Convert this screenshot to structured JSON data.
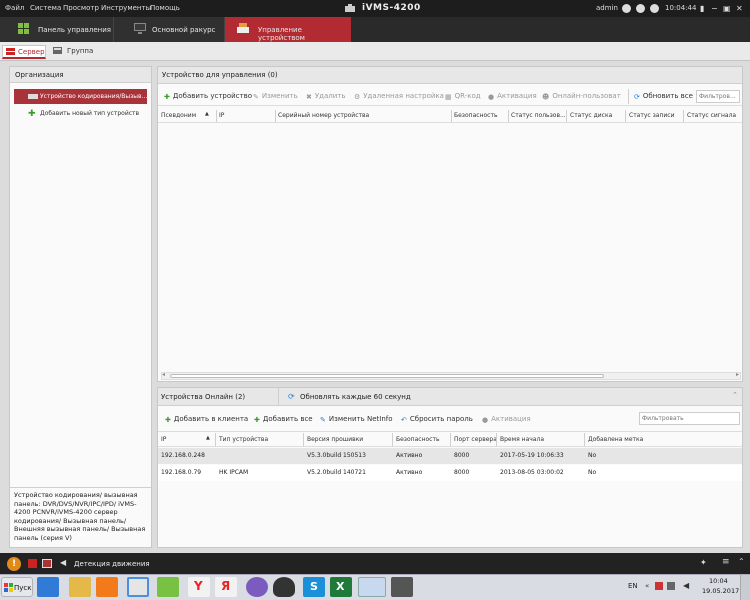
{
  "menu": {
    "items": [
      "Файл",
      "Система",
      "Просмотр",
      "Инструменты",
      "Помощь"
    ],
    "app_title": "iVMS-4200",
    "user": "admin",
    "time": "10:04:44"
  },
  "tabs": [
    {
      "label": "Панель управления",
      "active": false
    },
    {
      "label": "Основной ракурс",
      "active": false
    },
    {
      "label": "Управление устройством",
      "active": true
    }
  ],
  "subtabs": [
    {
      "label": "Сервер",
      "active": true
    },
    {
      "label": "Группа",
      "active": false
    }
  ],
  "left": {
    "header": "Организация",
    "items": [
      {
        "label": "Устройство кодирования/Вызыв...",
        "selected": true
      },
      {
        "label": "Добавить новый тип устройств",
        "selected": false
      }
    ],
    "description": "Устройство кодирования/ вызывная панель: DVR/DVS/NVR/IPC/IPD/ iVMS-4200 PCNVR/iVMS-4200 сервер кодирования/ Вызывная панель/ Внешняя вызывная панель/ Вызывная панель (серия V)"
  },
  "managed": {
    "header": "Устройство для управления (0)",
    "toolbar": {
      "add": "Добавить устройство",
      "edit": "Изменить",
      "delete": "Удалить",
      "remote": "Удаленная настройка",
      "qr": "QR-код",
      "activate": "Активация",
      "online_user": "Онлайн-пользоват",
      "refresh_all": "Обновить все",
      "filter_placeholder": "Фильтров..."
    },
    "columns": [
      "Псевдоним",
      "IP",
      "Серийный номер устройства",
      "Безопасность",
      "Статус пользов...",
      "Статус диска",
      "Статус записи",
      "Статус сигнала"
    ]
  },
  "online": {
    "header": "Устройства Онлайн (2)",
    "refresh": "Обновлять каждые 60 секунд",
    "toolbar": {
      "add_client": "Добавить в клиента",
      "add_all": "Добавить все",
      "edit_netinfo": "Изменить NetInfo",
      "reset_pw": "Сбросить пароль",
      "activate": "Активация",
      "filter_placeholder": "Фильтровать"
    },
    "columns": [
      "IP",
      "Тип устройства",
      "Версия прошивки",
      "Безопасность",
      "Порт сервера",
      "Время начала",
      "Добавлена метка"
    ],
    "rows": [
      [
        "192.168.0.248",
        "",
        "V5.3.0build 150513",
        "Активно",
        "8000",
        "2017-05-19 10:06:33",
        "No"
      ],
      [
        "192.168.0.79",
        "HK IPCAM",
        "V5.2.0build 140721",
        "Активно",
        "8000",
        "2013-08-05 03:00:02",
        "No"
      ]
    ]
  },
  "status": {
    "motion": "Детекция движения"
  },
  "taskbar": {
    "start": "Пуск",
    "lang": "EN",
    "time": "10:04",
    "date": "19.05.2017"
  },
  "colors": {
    "active_tab": "#b22b33",
    "accent_green": "#3a9a2c",
    "accent_blue": "#2a7bd1"
  }
}
